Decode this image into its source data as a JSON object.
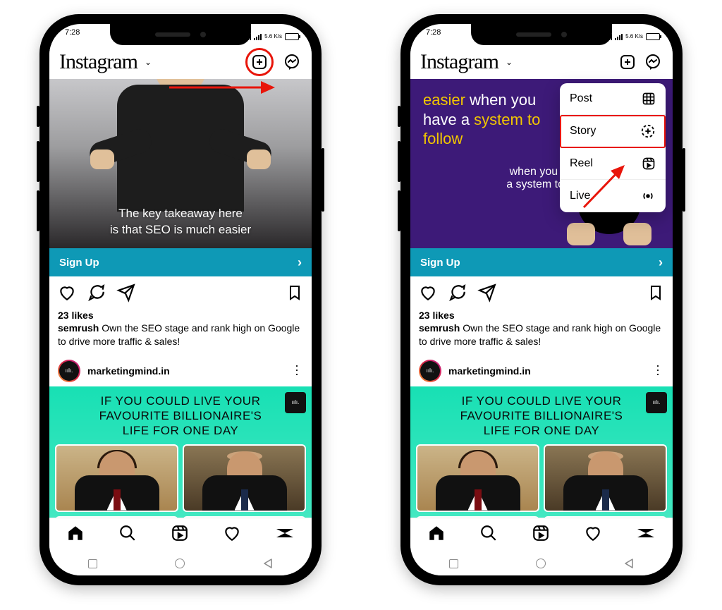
{
  "status": {
    "time": "7:28",
    "net": "5.6 K/s"
  },
  "header": {
    "logo": "Instagram"
  },
  "post1": {
    "overlay_l1": "The key takeaway here",
    "overlay_l2": "is that SEO is much easier",
    "purple_l1a": "easier ",
    "purple_l1b": "when you have a ",
    "purple_l2a": "system to ",
    "purple_l2b": "follow",
    "purple_sub_a": "when you ha",
    "purple_sub_b": "a system to fo",
    "cta": "Sign Up",
    "likes": "23 likes",
    "user": "semrush",
    "caption": " Own the SEO stage and rank high on Google to drive more traffic & sales!"
  },
  "post2": {
    "user": "marketingmind.in",
    "headline_l1": "IF YOU COULD LIVE YOUR",
    "headline_l2": "FAVOURITE BILLIONAIRE'S",
    "headline_l3": "LIFE FOR ONE DAY"
  },
  "menu": {
    "post": "Post",
    "story": "Story",
    "reel": "Reel",
    "live": "Live"
  }
}
